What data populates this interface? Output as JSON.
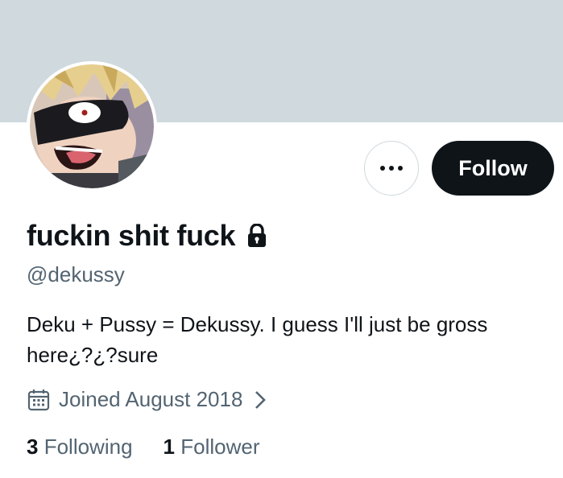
{
  "profile": {
    "display_name": "fuckin shit fuck",
    "handle": "@dekussy",
    "bio": "Deku + Pussy = Dekussy. I guess I'll just be gross here¿?¿?sure",
    "joined": "Joined August 2018",
    "is_protected": true
  },
  "actions": {
    "follow_label": "Follow",
    "more_icon": "more-horizontal-icon"
  },
  "stats": {
    "following_count": "3",
    "following_label": "Following",
    "followers_count": "1",
    "followers_label": "Follower"
  },
  "icons": {
    "lock": "lock-icon",
    "calendar": "calendar-icon",
    "chevron": "chevron-right-icon"
  },
  "colors": {
    "banner": "#cfd9de",
    "text_primary": "#0f1419",
    "text_secondary": "#536471",
    "button_dark": "#0f1419"
  }
}
